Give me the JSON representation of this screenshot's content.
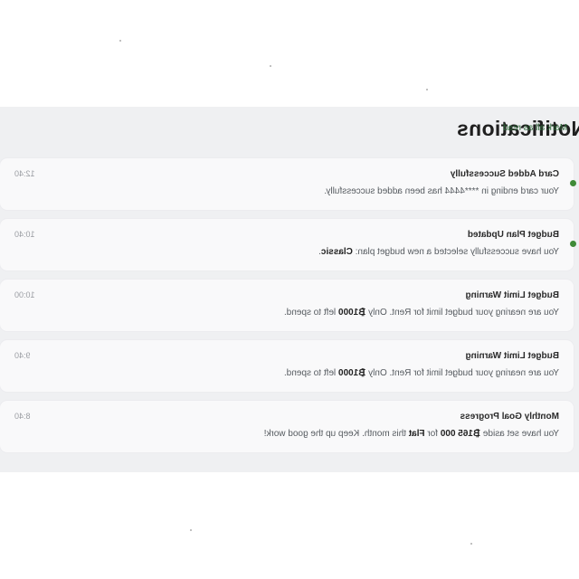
{
  "header": {
    "title": "Notifications",
    "mark_all_read": "Mark all as read"
  },
  "colors": {
    "accent": "#3f8a37",
    "link": "#2f6a3b",
    "panel_bg": "#eff0f2",
    "card_bg": "#f9f9fa"
  },
  "notifications": [
    {
      "title": "Card Added Successfully",
      "message_parts": [
        "Your card ending in ****4444 has been added successfully."
      ],
      "time": "12:40",
      "unread": true
    },
    {
      "title": "Budget Plan Updated",
      "message_parts": [
        "You have successfully selected a new budget plan: ",
        "Classic",
        "."
      ],
      "time": "10:40",
      "unread": true
    },
    {
      "title": "Budget Limit Warning",
      "message_parts": [
        "You are nearing your budget limit for Rent. Only ",
        "₿1000",
        " left to spend."
      ],
      "time": "10:00",
      "unread": false
    },
    {
      "title": "Budget Limit Warning",
      "message_parts": [
        "You are nearing your budget limit for Rent. Only ",
        "₿1000",
        " left to spend."
      ],
      "time": "9:40",
      "unread": false
    },
    {
      "title": "Monthly Goal Progress",
      "message_parts": [
        "You have set aside ",
        "₿165 000",
        " for ",
        "Flat",
        " this month. Keep up the good work!"
      ],
      "time": "8:40",
      "unread": false
    }
  ]
}
